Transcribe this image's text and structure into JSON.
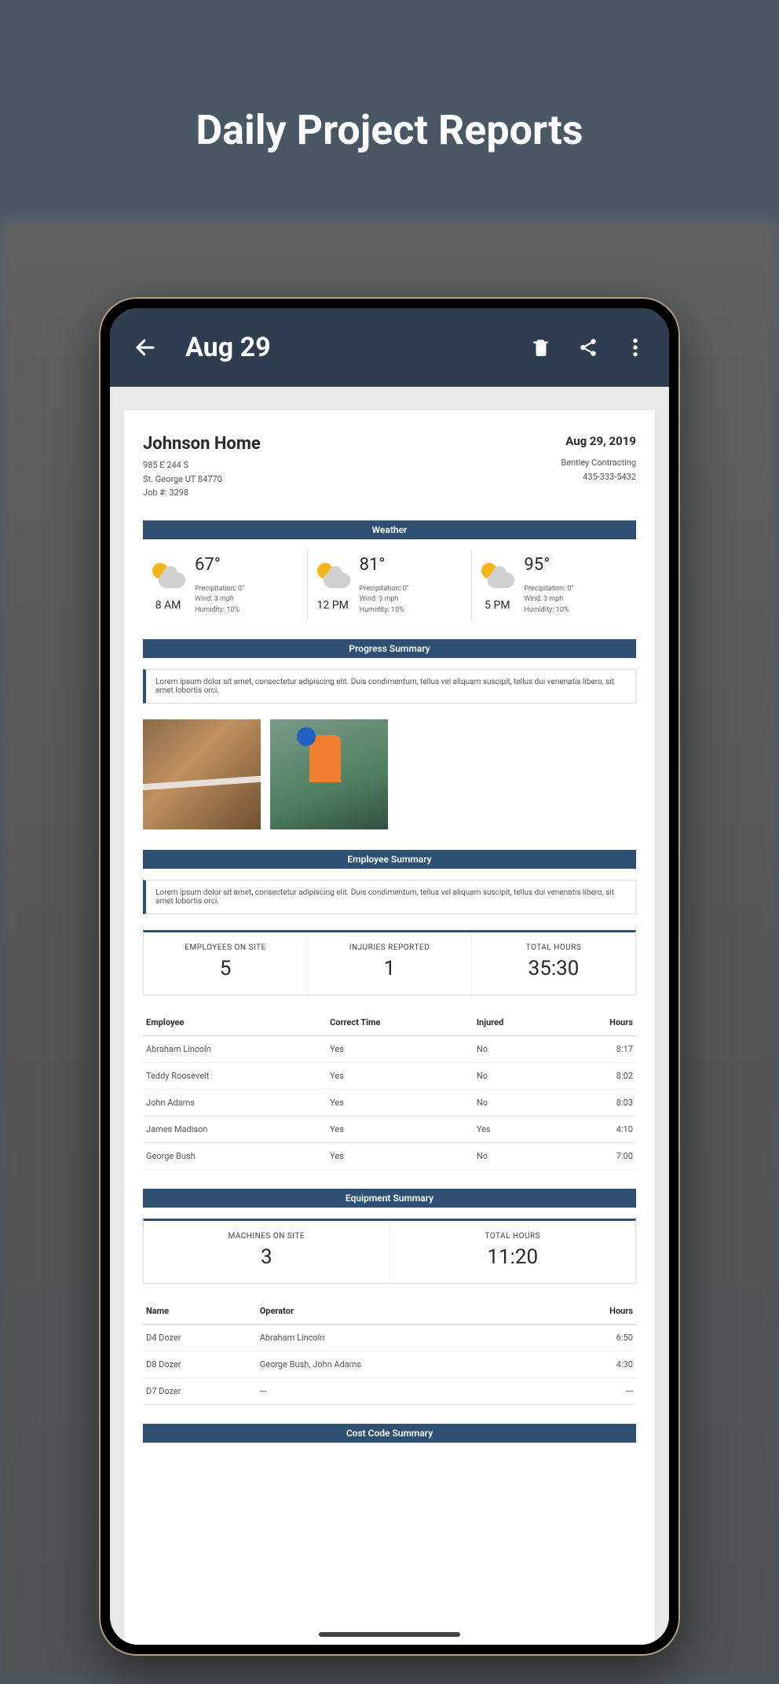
{
  "page": {
    "title": "Daily Project Reports"
  },
  "header": {
    "date_short": "Aug 29"
  },
  "report": {
    "client_name": "Johnson Home",
    "address": "985 E 244 S",
    "city_state": "St. George UT 84770",
    "job_no": "Job #: 3298",
    "report_date": "Aug 29, 2019",
    "company": "Bentley Contracting",
    "phone": "435-333-5432"
  },
  "sections": {
    "weather": "Weather",
    "progress": "Progress Summary",
    "employee": "Employee Summary",
    "equipment": "Equipment Summary",
    "costcode": "Cost Code Summary"
  },
  "weather": [
    {
      "temp": "67°",
      "time": "8 AM",
      "precip": "Precipitation: 0\"",
      "wind": "Wind: 3 mph",
      "humidity": "Humidity: 10%"
    },
    {
      "temp": "81°",
      "time": "12 PM",
      "precip": "Precipitation: 0\"",
      "wind": "Wind: 3 mph",
      "humidity": "Humidity: 10%"
    },
    {
      "temp": "95°",
      "time": "5 PM",
      "precip": "Precipitation: 0\"",
      "wind": "Wind: 3 mph",
      "humidity": "Humidity: 10%"
    }
  ],
  "lorem": "Lorem ipsum dolor sit amet, consectetur adipiscing elit. Duis condimentum, tellus vel aliquam suscipit, tellus dui venenatis libero, sit amet lobortis orci.",
  "employee_stats": {
    "on_site_label": "EMPLOYEES ON SITE",
    "on_site": "5",
    "injuries_label": "INJURIES REPORTED",
    "injuries": "1",
    "hours_label": "TOTAL HOURS",
    "hours": "35:30"
  },
  "employee_table": {
    "headers": {
      "name": "Employee",
      "correct": "Correct Time",
      "injured": "Injured",
      "hours": "Hours"
    },
    "rows": [
      {
        "name": "Abraham Lincoln",
        "correct": "Yes",
        "injured": "No",
        "hours": "8:17"
      },
      {
        "name": "Teddy Roosevelt",
        "correct": "Yes",
        "injured": "No",
        "hours": "8:02"
      },
      {
        "name": "John Adams",
        "correct": "Yes",
        "injured": "No",
        "hours": "8:03"
      },
      {
        "name": "James Madison",
        "correct": "Yes",
        "injured": "Yes",
        "hours": "4:10"
      },
      {
        "name": "George Bush",
        "correct": "Yes",
        "injured": "No",
        "hours": "7:00"
      }
    ]
  },
  "equipment_stats": {
    "machines_label": "MACHINES ON SITE",
    "machines": "3",
    "hours_label": "TOTAL HOURS",
    "hours": "11:20"
  },
  "equipment_table": {
    "headers": {
      "name": "Name",
      "operator": "Operator",
      "hours": "Hours"
    },
    "rows": [
      {
        "name": "D4 Dozer",
        "operator": "Abraham Lincoln",
        "hours": "6:50"
      },
      {
        "name": "D8 Dozer",
        "operator": "George Bush, John Adams",
        "hours": "4:30"
      },
      {
        "name": "D7 Dozer",
        "operator": "---",
        "hours": "---"
      }
    ]
  }
}
